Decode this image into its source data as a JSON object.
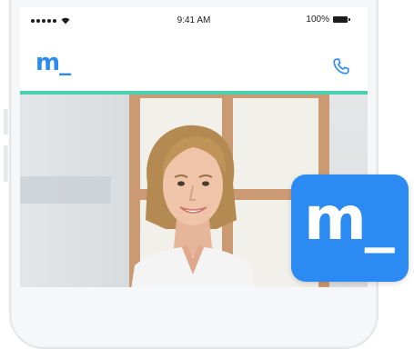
{
  "status_bar": {
    "time": "9:41 AM",
    "battery": "100%"
  },
  "app_bar": {
    "logo": "m_",
    "call_icon": "phone-icon"
  },
  "app_icon": {
    "logo": "m_"
  },
  "colors": {
    "brand": "#2b8bf2",
    "accent_line": "#48d1b0",
    "app_icon_bg": "#2b8bf2"
  }
}
